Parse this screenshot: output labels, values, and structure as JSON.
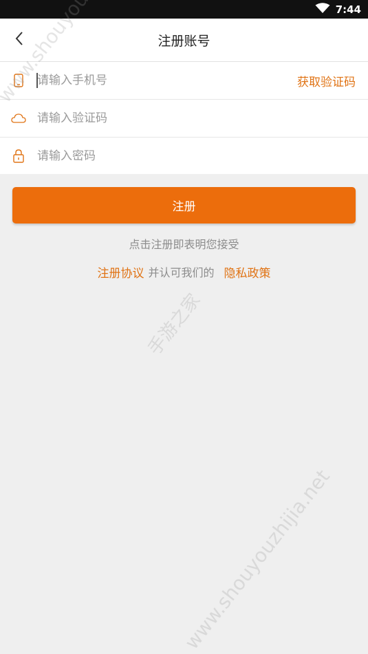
{
  "status_bar": {
    "time": "7:44"
  },
  "nav": {
    "title": "注册账号"
  },
  "form": {
    "phone_placeholder": "请输入手机号",
    "get_code_label": "获取验证码",
    "code_placeholder": "请输入验证码",
    "password_placeholder": "请输入密码"
  },
  "register_button": "注册",
  "agreement": {
    "notice": "点击注册即表明您接受",
    "terms_link": "注册协议",
    "middle_text": "并认可我们的",
    "privacy_link": "隐私政策"
  },
  "watermark": {
    "text": "www.shouyouzhijia.net",
    "text_cn": "手游之家"
  },
  "colors": {
    "accent": "#ec6d0c",
    "link": "#e07314",
    "background": "#efefef"
  }
}
